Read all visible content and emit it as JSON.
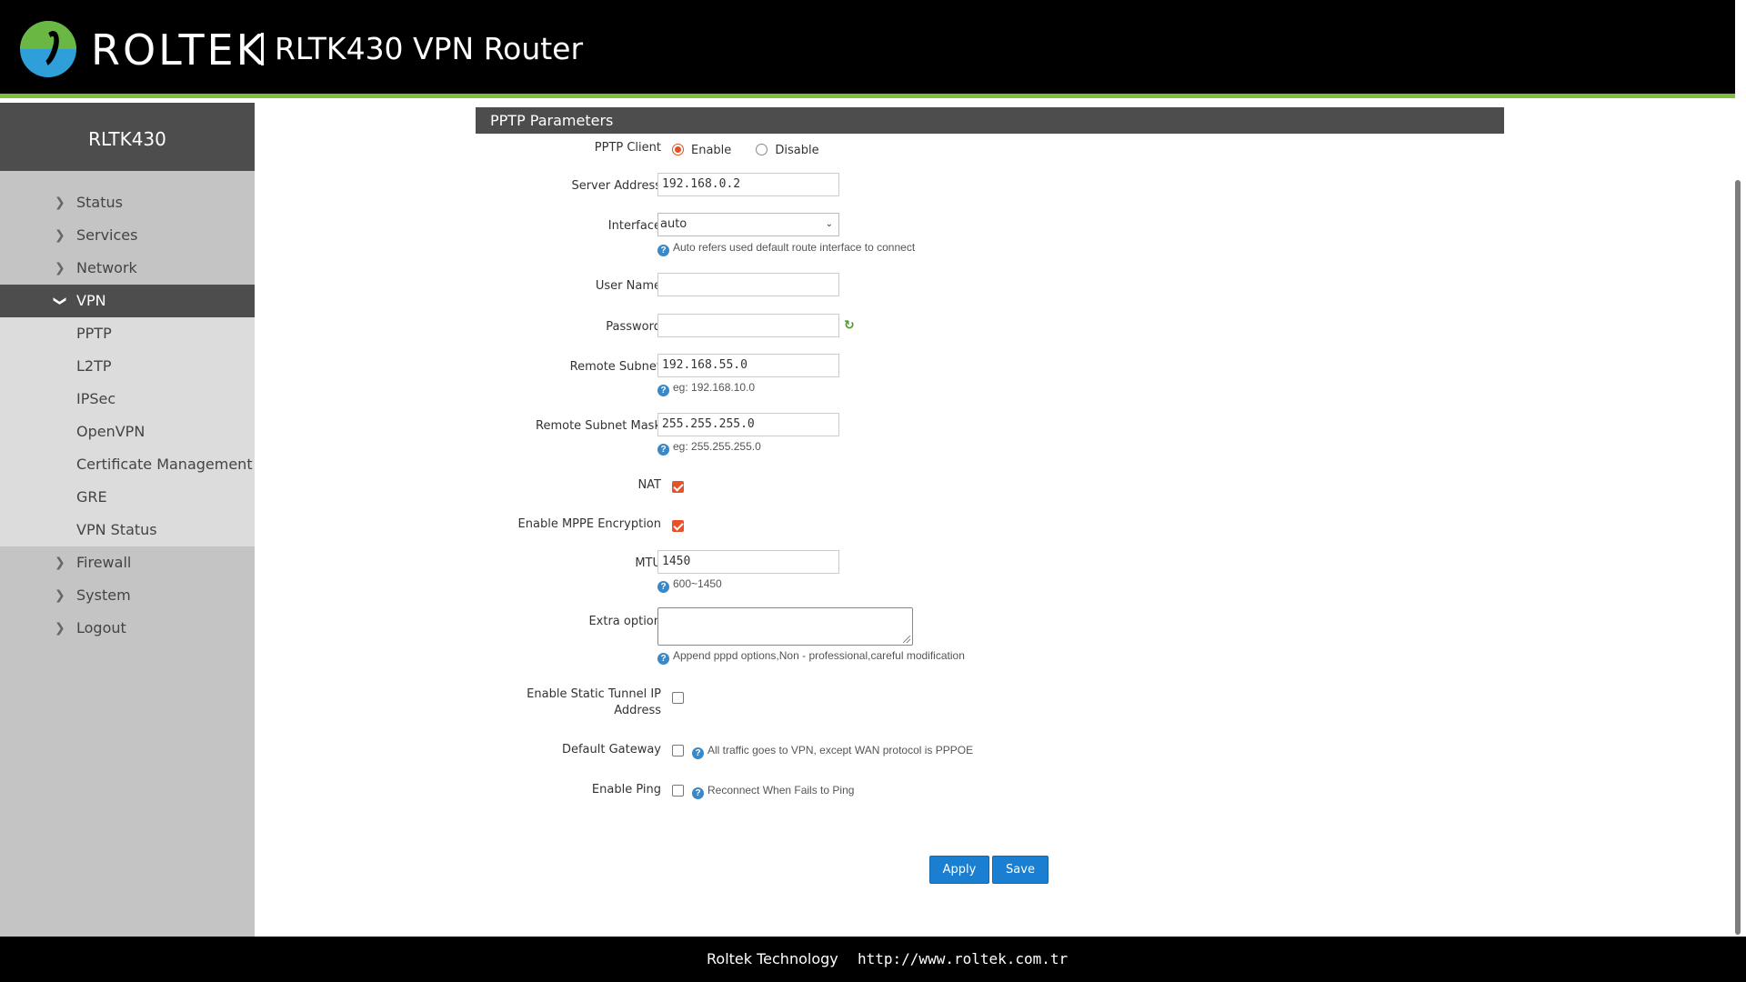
{
  "header": {
    "brand": "ROLTEK",
    "product": "RLTK430 VPN Router"
  },
  "sidebar": {
    "model": "RLTK430",
    "items": [
      {
        "label": "Status"
      },
      {
        "label": "Services"
      },
      {
        "label": "Network"
      },
      {
        "label": "VPN"
      },
      {
        "label": "Firewall"
      },
      {
        "label": "System"
      },
      {
        "label": "Logout"
      }
    ],
    "vpn_subitems": [
      {
        "label": "PPTP"
      },
      {
        "label": "L2TP"
      },
      {
        "label": "IPSec"
      },
      {
        "label": "OpenVPN"
      },
      {
        "label": "Certificate Management"
      },
      {
        "label": "GRE"
      },
      {
        "label": "VPN Status"
      }
    ]
  },
  "section": {
    "title": "PPTP Parameters"
  },
  "form": {
    "pptp_client": {
      "label": "PPTP Client",
      "enable": "Enable",
      "disable": "Disable",
      "selected": "Enable"
    },
    "server_address": {
      "label": "Server Address",
      "value": "192.168.0.2"
    },
    "interface": {
      "label": "Interface",
      "value": "auto",
      "hint": "Auto refers used default route interface to connect"
    },
    "user_name": {
      "label": "User Name",
      "value": ""
    },
    "password": {
      "label": "Password",
      "value": ""
    },
    "remote_subnet": {
      "label": "Remote Subnet",
      "value": "192.168.55.0",
      "hint": "eg: 192.168.10.0"
    },
    "remote_subnet_mask": {
      "label": "Remote Subnet Mask",
      "value": "255.255.255.0",
      "hint": "eg: 255.255.255.0"
    },
    "nat": {
      "label": "NAT",
      "checked": true
    },
    "mppe": {
      "label": "Enable MPPE Encryption",
      "checked": true
    },
    "mtu": {
      "label": "MTU",
      "value": "1450",
      "hint": "600~1450"
    },
    "extra_option": {
      "label": "Extra option",
      "value": "",
      "hint": "Append pppd options,Non - professional,careful modification"
    },
    "static_tunnel": {
      "label_line1": "Enable Static Tunnel IP",
      "label_line2": "Address",
      "checked": false
    },
    "default_gateway": {
      "label": "Default Gateway",
      "checked": false,
      "hint": "All traffic goes to VPN, except WAN protocol is PPPOE"
    },
    "enable_ping": {
      "label": "Enable Ping",
      "checked": false,
      "hint": "Reconnect When Fails to Ping"
    }
  },
  "buttons": {
    "apply": "Apply",
    "save": "Save"
  },
  "footer": {
    "company": "Roltek Technology",
    "url": "http://www.roltek.com.tr"
  },
  "icons": {
    "help": "help-icon",
    "refresh": "refresh-icon",
    "logo": "roltek-logo-icon"
  },
  "colors": {
    "accent": "#7fbf3f",
    "button": "#1b7fd1",
    "checkbox": "#e8522a"
  }
}
